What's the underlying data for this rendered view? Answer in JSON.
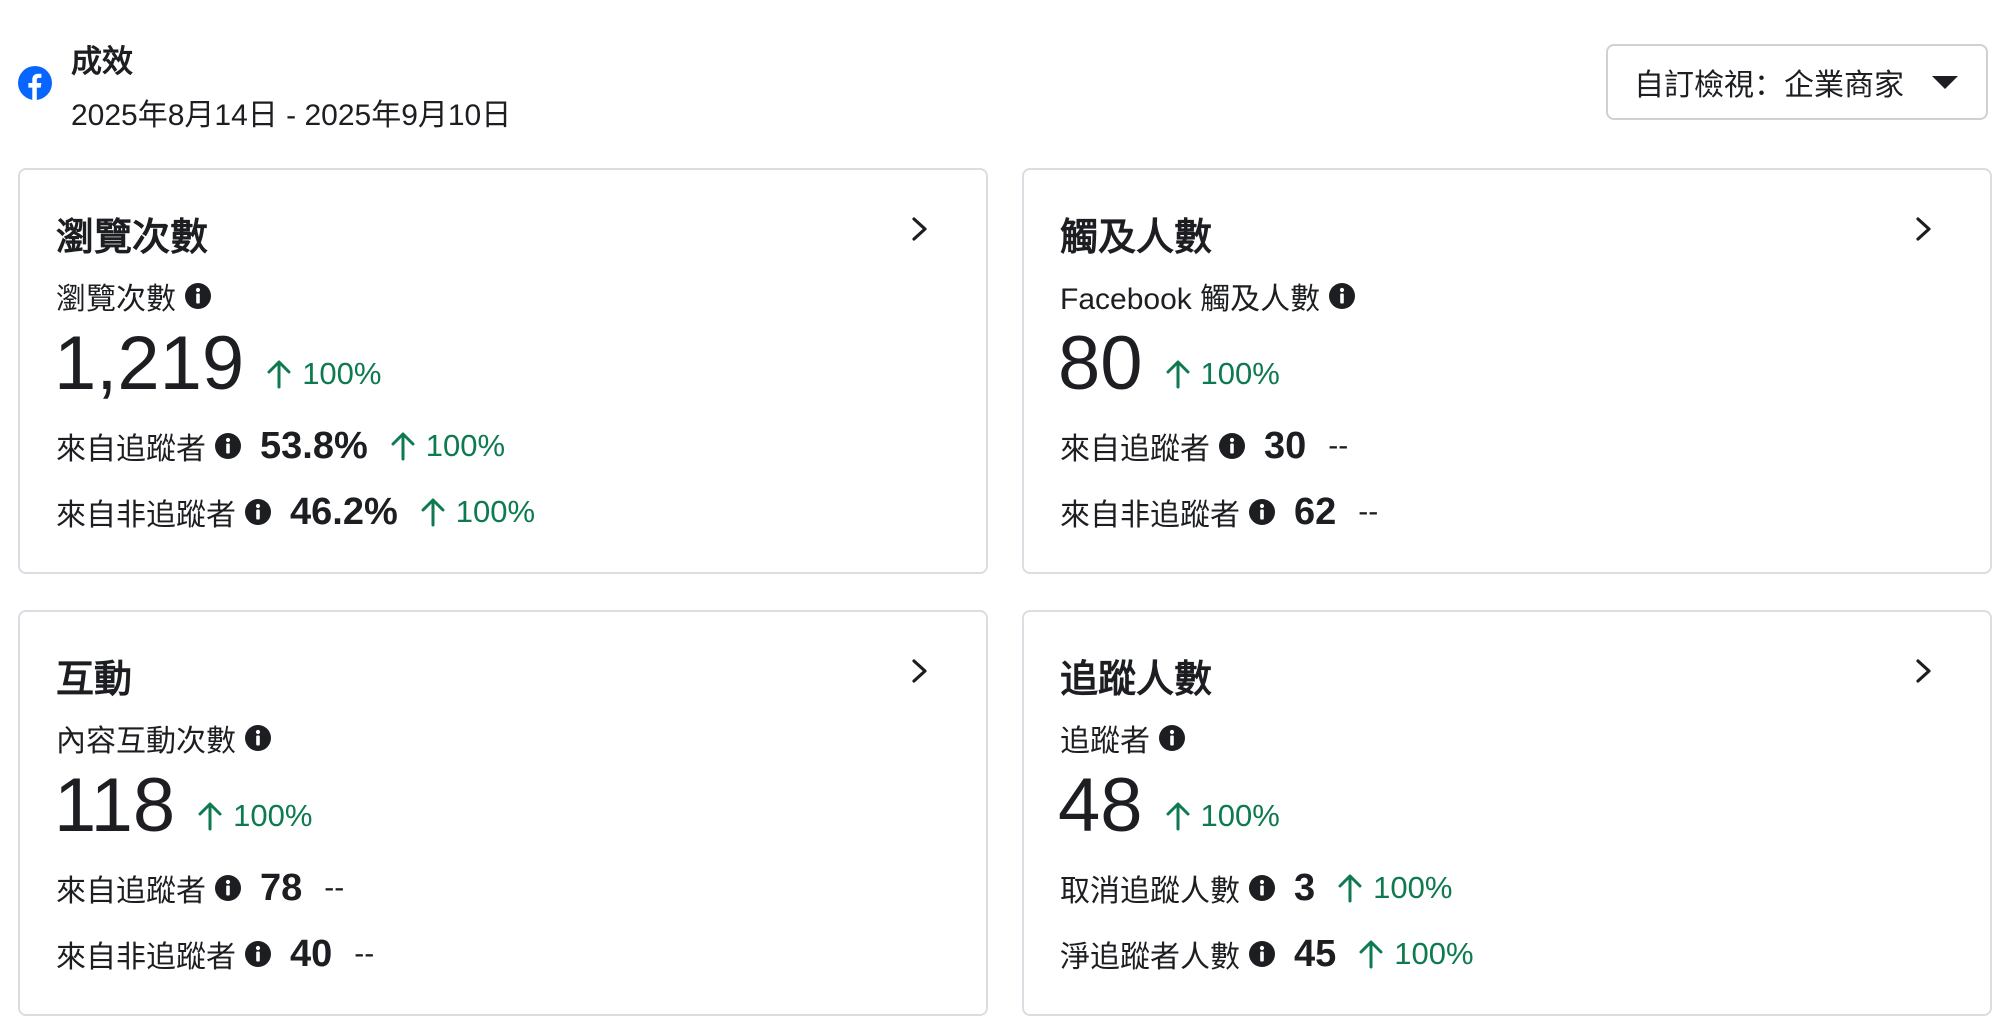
{
  "header": {
    "title": "成效",
    "date_range": "2025年8月14日 - 2025年9月10日",
    "view_select": "自訂檢視：企業商家"
  },
  "colors": {
    "positive": "#0e7a4f",
    "brand": "#0866ff",
    "border": "#dadde1"
  },
  "cards": {
    "views": {
      "title": "瀏覽次數",
      "metric_label": "瀏覽次數",
      "value": "1,219",
      "delta": "100%",
      "rows": [
        {
          "label": "來自追蹤者",
          "value": "53.8%",
          "delta": "100%"
        },
        {
          "label": "來自非追蹤者",
          "value": "46.2%",
          "delta": "100%"
        }
      ]
    },
    "reach": {
      "title": "觸及人數",
      "metric_label": "Facebook 觸及人數",
      "value": "80",
      "delta": "100%",
      "rows": [
        {
          "label": "來自追蹤者",
          "value": "30",
          "delta": "--"
        },
        {
          "label": "來自非追蹤者",
          "value": "62",
          "delta": "--"
        }
      ]
    },
    "interactions": {
      "title": "互動",
      "metric_label": "內容互動次數",
      "value": "118",
      "delta": "100%",
      "rows": [
        {
          "label": "來自追蹤者",
          "value": "78",
          "delta": "--"
        },
        {
          "label": "來自非追蹤者",
          "value": "40",
          "delta": "--"
        }
      ]
    },
    "followers": {
      "title": "追蹤人數",
      "metric_label": "追蹤者",
      "value": "48",
      "delta": "100%",
      "rows": [
        {
          "label": "取消追蹤人數",
          "value": "3",
          "delta": "100%"
        },
        {
          "label": "淨追蹤者人數",
          "value": "45",
          "delta": "100%"
        }
      ]
    }
  }
}
